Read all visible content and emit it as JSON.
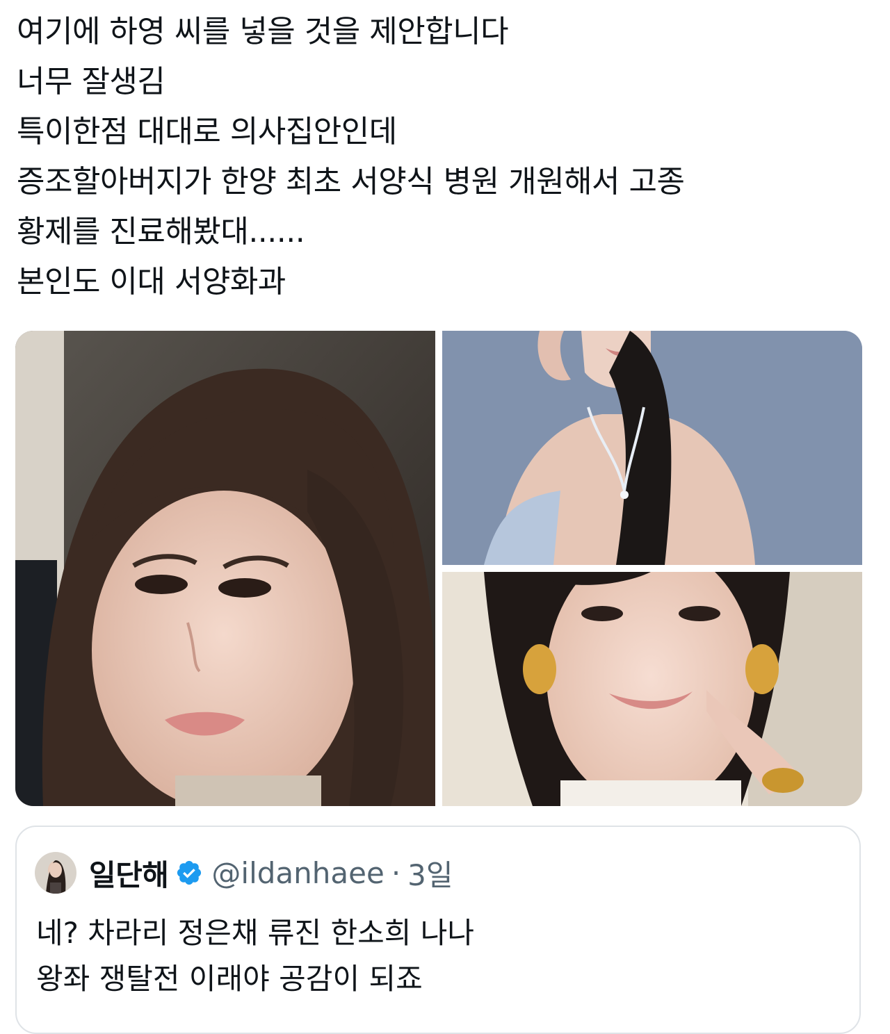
{
  "tweet": {
    "lines": [
      "여기에 하영 씨를 넣을 것을 제안합니다",
      "너무 잘생김",
      "특이한점 대대로 의사집안인데",
      "증조할아버지가 한양 최초 서양식 병원 개원해서 고종",
      "황제를 진료해봤대......",
      "본인도 이대 서양화과"
    ]
  },
  "media": {
    "photo_count": 3
  },
  "quoted_tweet": {
    "display_name": "일단해",
    "handle": "@ildanhaee",
    "separator": "·",
    "timestamp": "3일",
    "verified": true,
    "verified_color": "#1d9bf0",
    "lines": [
      "네?  차라리 정은채 류진 한소희 나나",
      "왕좌 쟁탈전 이래야 공감이 되죠"
    ]
  },
  "colors": {
    "text_primary": "#0f1419",
    "text_secondary": "#536471",
    "card_border": "#dfe3e7"
  }
}
